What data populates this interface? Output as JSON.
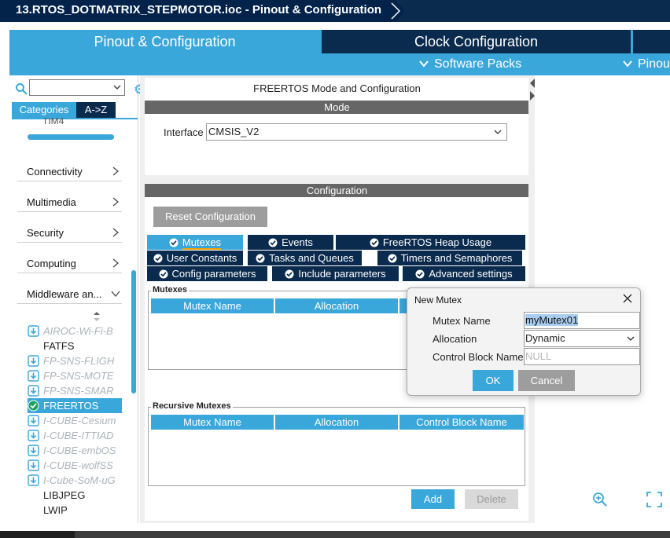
{
  "window": {
    "title": "13.RTOS_DOTMATRIX_STEPMOTOR.ioc - Pinout & Configuration"
  },
  "tabs": {
    "main": [
      "Pinout & Configuration",
      "Clock Configuration",
      ""
    ],
    "sub": [
      "Software Packs",
      "Pinout"
    ]
  },
  "left": {
    "search_value": "",
    "category_tabs": [
      "Categories",
      "A->Z"
    ],
    "partial_item": "TIM4",
    "categories": [
      "Connectivity",
      "Multimedia",
      "Security",
      "Computing",
      "Middleware an..."
    ],
    "middleware": [
      {
        "label": "AIROC-Wi-Fi-B",
        "state": "pack"
      },
      {
        "label": "FATFS",
        "state": "plain"
      },
      {
        "label": "FP-SNS-FLIGH",
        "state": "pack"
      },
      {
        "label": "FP-SNS-MOTE",
        "state": "pack"
      },
      {
        "label": "FP-SNS-SMAR",
        "state": "pack"
      },
      {
        "label": "FREERTOS",
        "state": "selected"
      },
      {
        "label": "I-CUBE-Cesium",
        "state": "pack"
      },
      {
        "label": "I-CUBE-ITTIAD",
        "state": "pack"
      },
      {
        "label": "I-CUBE-embOS",
        "state": "pack"
      },
      {
        "label": "I-CUBE-wolfSS",
        "state": "pack"
      },
      {
        "label": "I-Cube-SoM-uG",
        "state": "pack"
      },
      {
        "label": "LIBJPEG",
        "state": "plain"
      },
      {
        "label": "LWIP",
        "state": "plain"
      }
    ]
  },
  "center": {
    "title": "FREERTOS Mode and Configuration",
    "mode_header": "Mode",
    "interface_label": "Interface",
    "interface_value": "CMSIS_V2",
    "config_header": "Configuration",
    "reset_label": "Reset Configuration",
    "config_tabs": [
      "Mutexes",
      "Events",
      "FreeRTOS Heap Usage",
      "User Constants",
      "Tasks and Queues",
      "Timers and Semaphores",
      "Config parameters",
      "Include parameters",
      "Advanced settings"
    ],
    "mutexes_legend": "Mutexes",
    "recursive_legend": "Recursive Mutexes",
    "columns": [
      "Mutex Name",
      "Allocation",
      "Control Block Name"
    ],
    "add_label": "Add",
    "delete_label": "Delete"
  },
  "dialog": {
    "title": "New Mutex",
    "name_label": "Mutex Name",
    "name_value": "myMutex01",
    "alloc_label": "Allocation",
    "alloc_value": "Dynamic",
    "cb_label": "Control Block Name",
    "cb_placeholder": "NULL",
    "ok_label": "OK",
    "cancel_label": "Cancel"
  },
  "colors": {
    "accent": "#3aa7da",
    "navy": "#0b2b4e",
    "gray_button": "#9d9d9d"
  }
}
